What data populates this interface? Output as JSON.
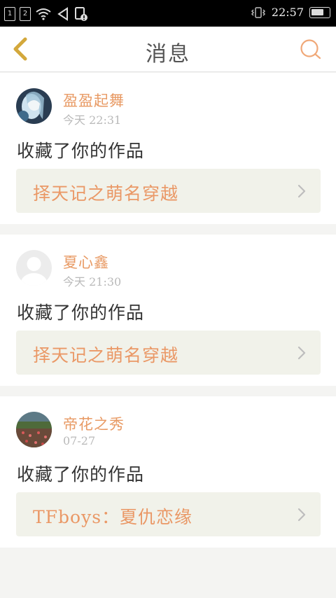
{
  "status_bar": {
    "sim1": "1",
    "sim2": "2",
    "clock": "22:57"
  },
  "header": {
    "title": "消息"
  },
  "messages": [
    {
      "username": "盈盈起舞",
      "time": "今天 22:31",
      "action": "收藏了你的作品",
      "work_title": "择天记之萌名穿越"
    },
    {
      "username": "夏心鑫",
      "time": "今天 21:30",
      "action": "收藏了你的作品",
      "work_title": "择天记之萌名穿越"
    },
    {
      "username": "帝花之秀",
      "time": "07-27",
      "action": "收藏了你的作品",
      "work_title": "TFboys：夏仇恋缘"
    }
  ],
  "colors": {
    "accent": "#e89a64",
    "back_arrow": "#d3a83c",
    "work_box_bg": "#f1f2ea",
    "page_bg": "#f4f4f2"
  },
  "icons": {
    "back": "chevron-left-icon",
    "search": "search-icon",
    "row_arrow": "chevron-right-icon"
  }
}
